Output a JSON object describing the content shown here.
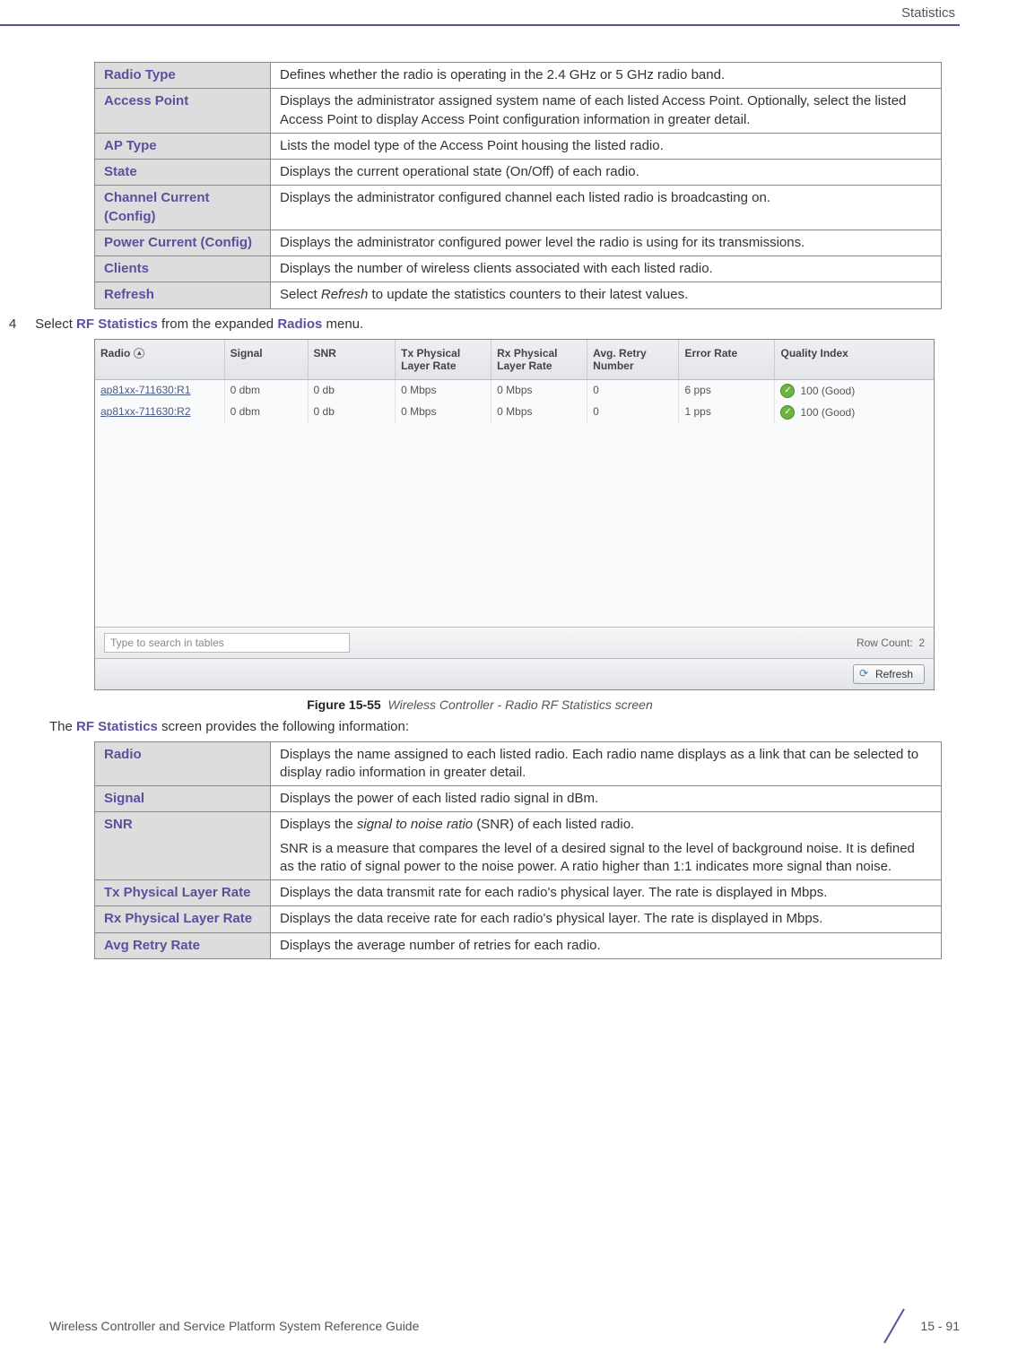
{
  "header": {
    "section": "Statistics"
  },
  "table1": {
    "rows": [
      {
        "term": "Radio Type",
        "desc": "Defines whether the radio is operating in the 2.4 GHz or 5 GHz radio band."
      },
      {
        "term": "Access Point",
        "desc": "Displays the administrator assigned system name of each listed Access Point. Optionally, select the listed Access Point to display Access Point configuration information in greater detail."
      },
      {
        "term": "AP Type",
        "desc": "Lists the model type of the Access Point housing the listed radio."
      },
      {
        "term": "State",
        "desc": "Displays the current operational state (On/Off) of each radio."
      },
      {
        "term": "Channel Current (Config)",
        "desc": "Displays the administrator configured channel each listed radio is broadcasting on."
      },
      {
        "term": "Power Current (Config)",
        "desc": "Displays the administrator configured power level the radio is using for its transmissions."
      },
      {
        "term": "Clients",
        "desc": "Displays the number of wireless clients associated with each listed radio."
      },
      {
        "term": "Refresh",
        "desc_prefix": "Select ",
        "desc_italic": "Refresh",
        "desc_suffix": " to update the statistics counters to their latest values."
      }
    ]
  },
  "step4": {
    "number": "4",
    "prefix": "Select ",
    "link1": "RF Statistics",
    "mid": " from the expanded ",
    "link2": "Radios",
    "suffix": " menu."
  },
  "screenshot": {
    "columns": {
      "radio": "Radio",
      "signal": "Signal",
      "snr": "SNR",
      "tx": "Tx Physical Layer Rate",
      "rx": "Rx Physical Layer Rate",
      "avg": "Avg. Retry Number",
      "err": "Error Rate",
      "qi": "Quality Index"
    },
    "rows": [
      {
        "radio": "ap81xx-711630:R1",
        "signal": "0 dbm",
        "snr": "0 db",
        "tx": "0 Mbps",
        "rx": "0 Mbps",
        "avg": "0",
        "err": "6 pps",
        "qi": "100 (Good)"
      },
      {
        "radio": "ap81xx-711630:R2",
        "signal": "0 dbm",
        "snr": "0 db",
        "tx": "0 Mbps",
        "rx": "0 Mbps",
        "avg": "0",
        "err": "1 pps",
        "qi": "100 (Good)"
      }
    ],
    "search_placeholder": "Type to search in tables",
    "row_count_label": "Row Count:",
    "row_count_value": "2",
    "refresh_label": "Refresh"
  },
  "figure": {
    "label": "Figure 15-55",
    "caption": "Wireless Controller - Radio RF Statistics screen"
  },
  "para2": {
    "prefix": "The ",
    "bold": "RF Statistics",
    "suffix": " screen provides the following information:"
  },
  "table2": {
    "rows": [
      {
        "term": "Radio",
        "desc": "Displays the name assigned to each listed radio. Each radio name displays as a link that can be selected to display radio information in greater detail."
      },
      {
        "term": "Signal",
        "desc": "Displays the power of each listed radio signal in dBm."
      },
      {
        "term": "SNR",
        "desc_prefix": "Displays the ",
        "desc_italic": "signal to noise ratio",
        "desc_suffix": " (SNR) of each listed radio.",
        "desc2": "SNR is a measure that compares the level of a desired signal to the level of background noise. It is defined as the ratio of signal power to the noise power. A ratio higher than 1:1 indicates more signal than noise."
      },
      {
        "term": "Tx Physical Layer Rate",
        "desc": "Displays the data transmit rate for each radio's physical layer. The rate is displayed in Mbps."
      },
      {
        "term": "Rx Physical Layer Rate",
        "desc": "Displays the data receive rate for each radio's physical layer. The rate is displayed in Mbps."
      },
      {
        "term": "Avg Retry Rate",
        "desc": "Displays the average number of retries for each radio."
      }
    ]
  },
  "footer": {
    "left": "Wireless Controller and Service Platform System Reference Guide",
    "right": "15 - 91"
  }
}
